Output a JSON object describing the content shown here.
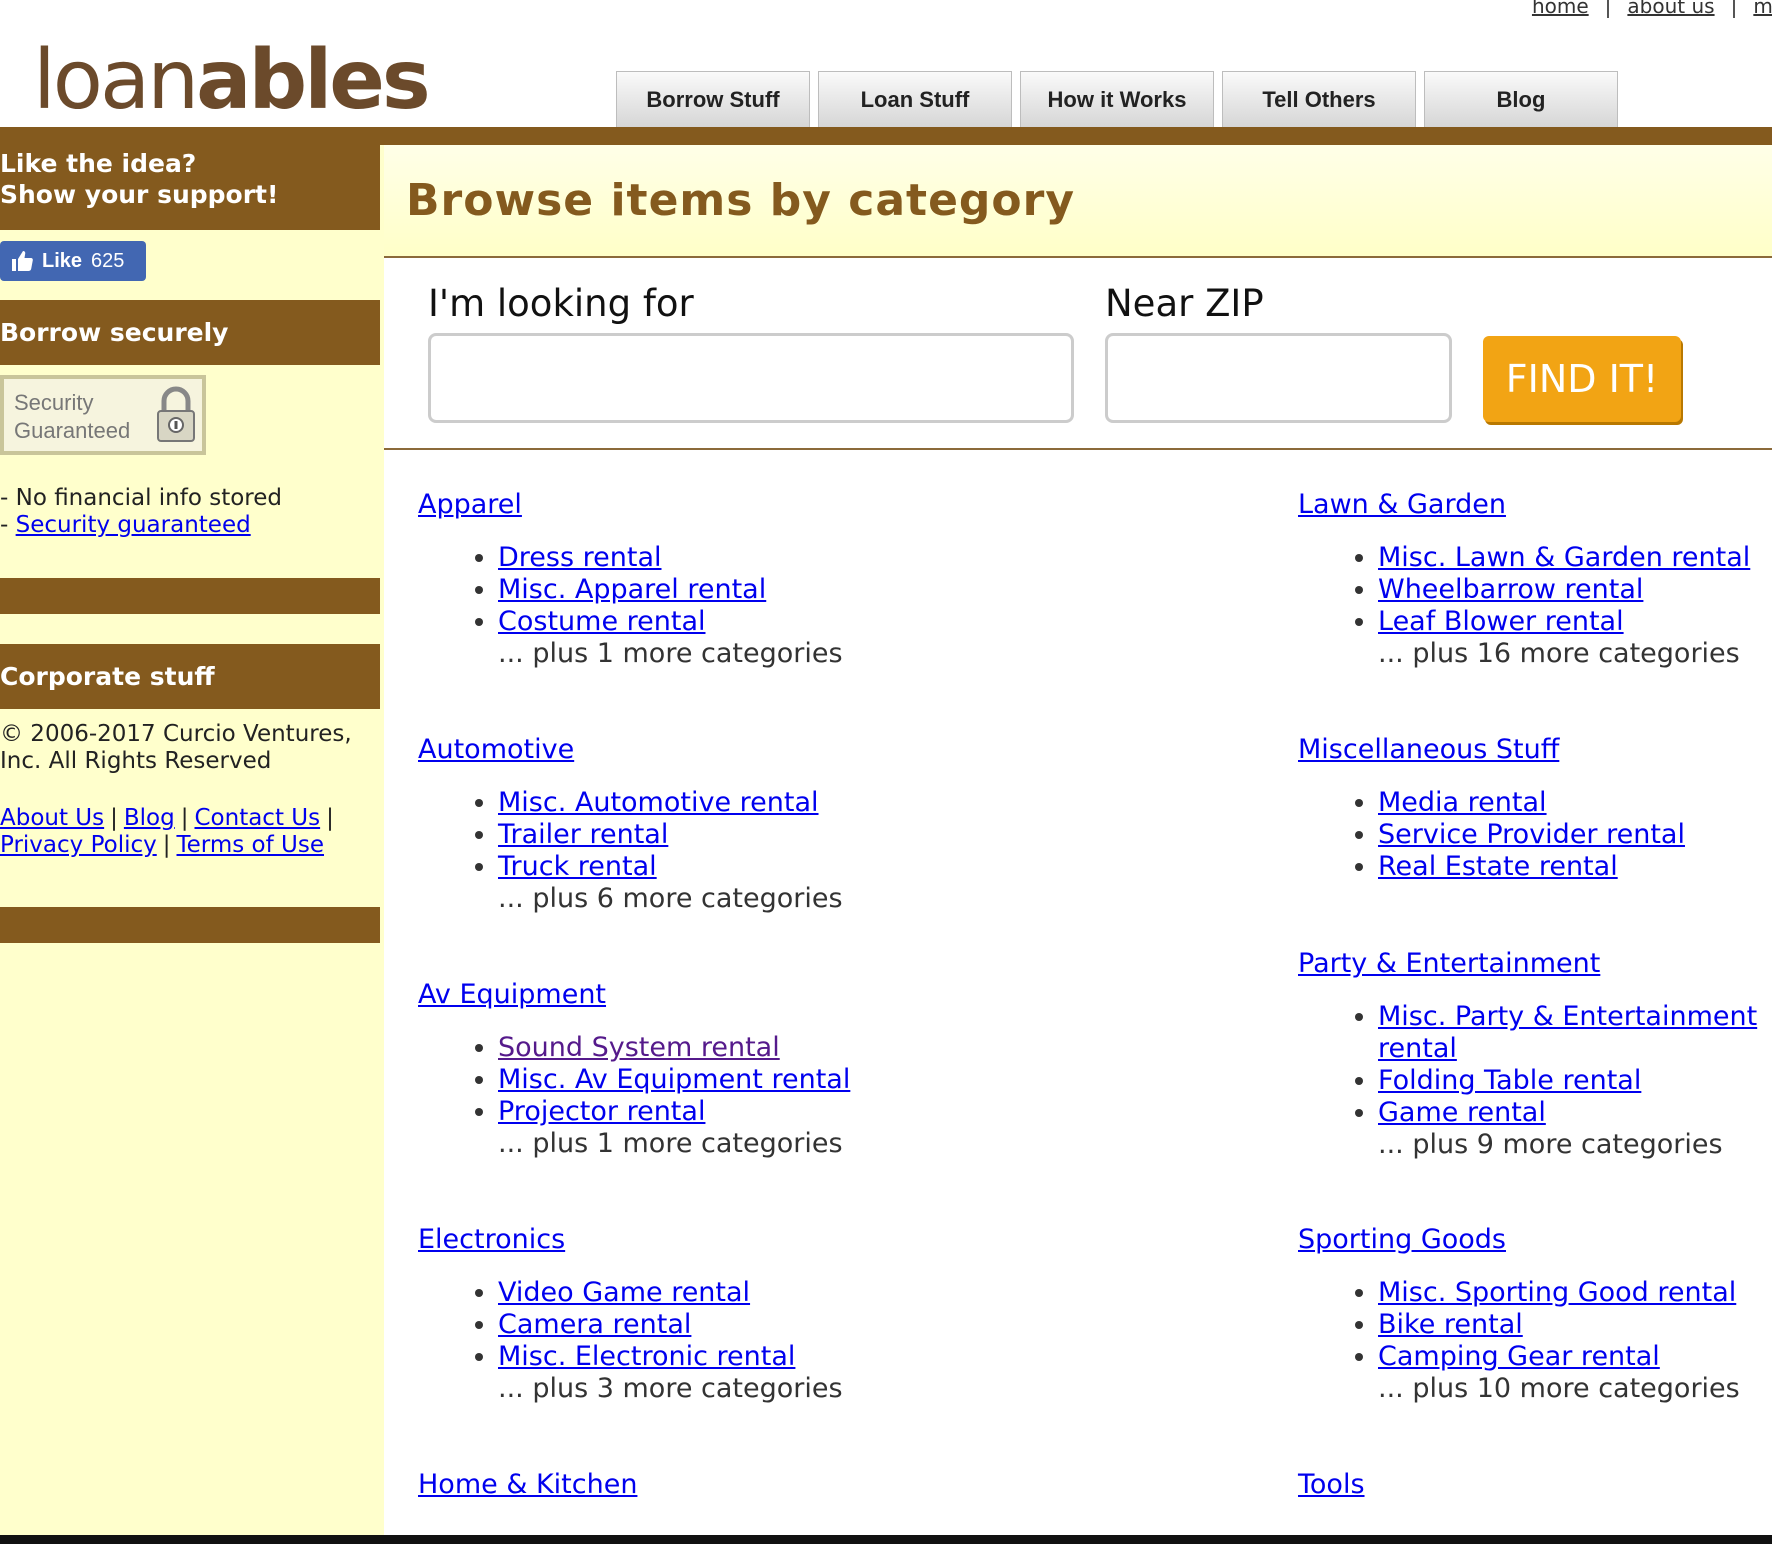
{
  "top_links": [
    "home",
    "about us",
    "my c"
  ],
  "logo": {
    "prefix": "loan",
    "suffix": "ables"
  },
  "nav": [
    "Borrow Stuff",
    "Loan Stuff",
    "How it Works",
    "Tell Others",
    "Blog"
  ],
  "sidebar": {
    "support_line1": "Like the idea?",
    "support_line2": "Show your support!",
    "like": {
      "label": "Like",
      "count": "625"
    },
    "borrow_heading": "Borrow securely",
    "badge_line1": "Security",
    "badge_line2": "Guaranteed",
    "info_line1": "- No financial info stored",
    "info_dash": "- ",
    "info_link": "Security guaranteed",
    "corporate_heading": "Corporate stuff",
    "copyright_line1": "© 2006-2017 Curcio Ventures,",
    "copyright_line2": "Inc. All Rights Reserved",
    "links_row1": [
      "About Us",
      "Blog",
      "Contact Us"
    ],
    "links_row2": [
      "Privacy Policy",
      "Terms of Use"
    ],
    "separator": "|"
  },
  "main": {
    "title": "Browse items by category",
    "search": {
      "looking_label": "I'm looking for",
      "looking_value": "",
      "zip_label": "Near ZIP",
      "zip_value": "",
      "button": "FIND IT!"
    },
    "categories_left": [
      {
        "name": "Apparel",
        "items": [
          "Dress rental",
          "Misc. Apparel rental",
          "Costume rental"
        ],
        "more": "... plus 1 more categories"
      },
      {
        "name": "Automotive",
        "items": [
          "Misc. Automotive rental",
          "Trailer rental",
          "Truck rental"
        ],
        "more": "... plus 6 more categories"
      },
      {
        "name": "Av Equipment",
        "items": [
          "Sound System rental",
          "Misc. Av Equipment rental",
          "Projector rental"
        ],
        "more": "... plus 1 more categories"
      },
      {
        "name": "Electronics",
        "items": [
          "Video Game rental",
          "Camera rental",
          "Misc. Electronic rental"
        ],
        "more": "... plus 3 more categories"
      },
      {
        "name": "Home & Kitchen"
      }
    ],
    "categories_right": [
      {
        "name": "Lawn & Garden",
        "items": [
          "Misc. Lawn & Garden rental",
          "Wheelbarrow rental",
          "Leaf Blower rental"
        ],
        "more": "... plus 16 more categories"
      },
      {
        "name": "Miscellaneous Stuff",
        "items": [
          "Media rental",
          "Service Provider rental",
          "Real Estate rental"
        ]
      },
      {
        "name": "Party & Entertainment",
        "items": [
          "Misc. Party & Entertainment",
          "rental",
          "Folding Table rental",
          "Game rental"
        ],
        "more": "... plus 9 more categories"
      },
      {
        "name": "Sporting Goods",
        "items": [
          "Misc. Sporting Good rental",
          "Bike rental",
          "Camping Gear rental"
        ],
        "more": "... plus 10 more categories"
      },
      {
        "name": "Tools"
      }
    ]
  }
}
